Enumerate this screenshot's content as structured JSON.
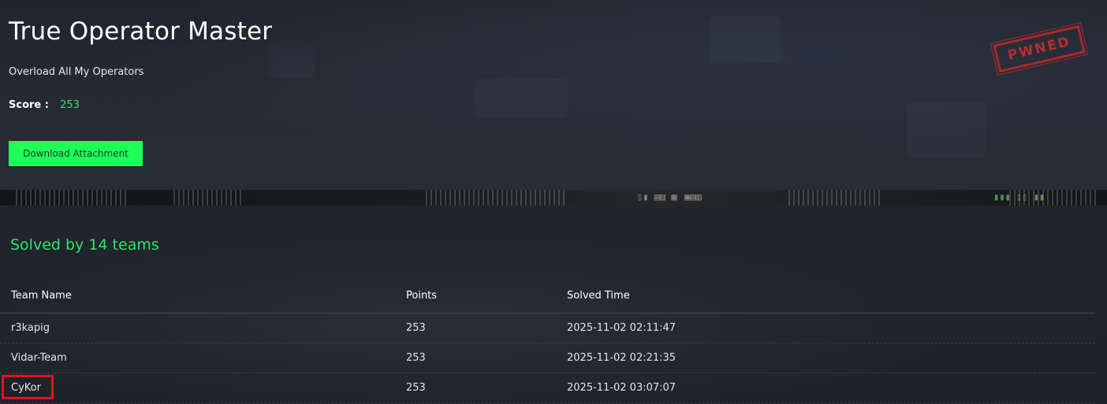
{
  "challenge": {
    "title": "True Operator Master",
    "subtitle": "Overload All My Operators",
    "score_label": "Score :",
    "score_value": "253",
    "download_label": "Download Attachment",
    "stamp_text": "PWNED"
  },
  "solves": {
    "heading": "Solved by 14 teams",
    "columns": [
      "Team Name",
      "Points",
      "Solved Time"
    ],
    "rows": [
      {
        "team": "r3kapig",
        "points": "253",
        "time": "2025-11-02 02:11:47"
      },
      {
        "team": "Vidar-Team",
        "points": "253",
        "time": "2025-11-02 02:21:35"
      },
      {
        "team": "CyKor",
        "points": "253",
        "time": "2025-11-02 03:07:07"
      }
    ]
  },
  "colors": {
    "accent_green": "#2ee66a",
    "button_green": "#1fff5a",
    "stamp_red": "#b8282a",
    "highlight_red": "#e0141e",
    "background": "#1f232b"
  },
  "icons": {
    "stamp": "pwned-stamp"
  }
}
